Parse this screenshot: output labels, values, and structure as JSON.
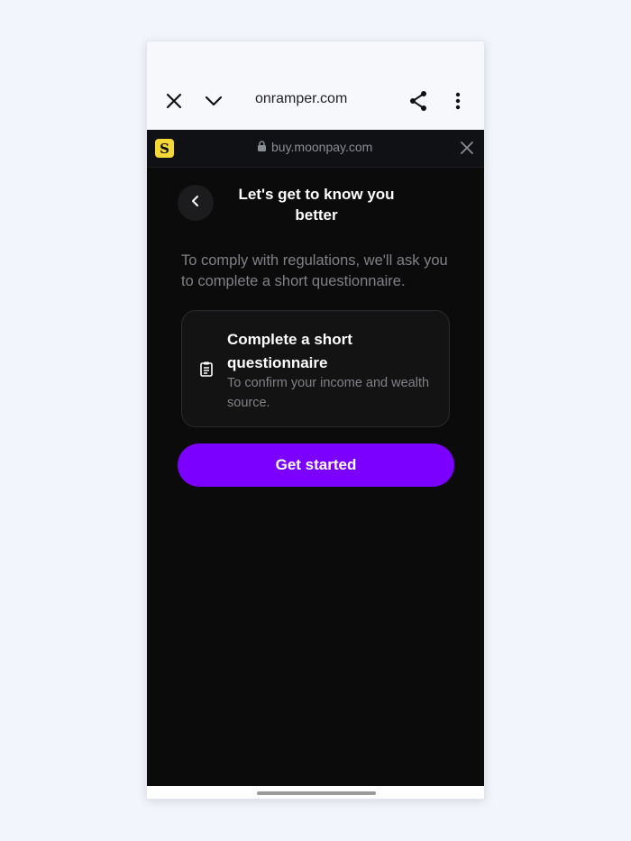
{
  "browser": {
    "url": "onramper.com"
  },
  "sheet": {
    "url": "buy.moonpay.com",
    "logo_letter": "S",
    "logo_color": "#f4d835"
  },
  "page": {
    "title": "Let's get to know you better",
    "intro": "To comply with regulations, we'll ask you to complete a short questionnaire."
  },
  "card": {
    "icon": "clipboard-icon",
    "title": "Complete a short questionnaire",
    "subtitle": "To confirm your income and wealth source."
  },
  "cta": {
    "label": "Get started",
    "color": "#7b00ff"
  }
}
